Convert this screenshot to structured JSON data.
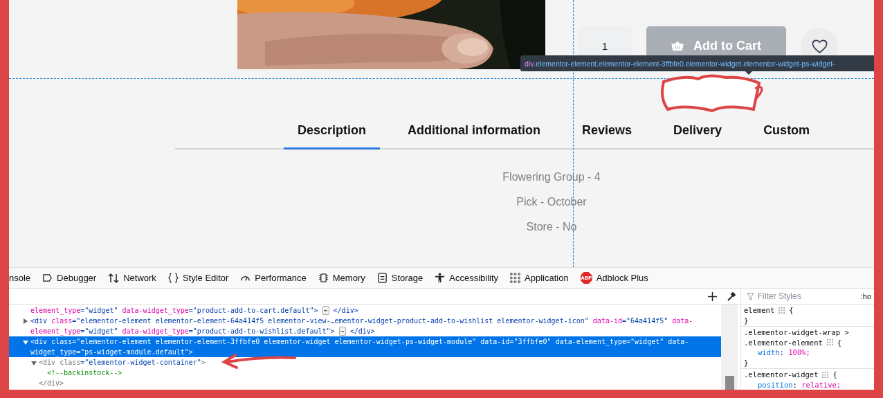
{
  "product": {
    "quantity": "1",
    "add_to_cart": "Add to Cart",
    "wishlist_selected": false
  },
  "highlighter": {
    "tag": "div",
    "selector": ".elementor-element.elementor-element-3ffbfe0.elementor-widget.elementor-widget-ps-widget-"
  },
  "tabs": [
    {
      "label": "Description",
      "selected": true
    },
    {
      "label": "Additional information",
      "selected": false
    },
    {
      "label": "Reviews",
      "selected": false
    },
    {
      "label": "Delivery",
      "selected": false
    },
    {
      "label": "Custom",
      "selected": false
    }
  ],
  "description": [
    "Flowering Group - 4",
    "Pick - October",
    "Store - No"
  ],
  "devtools": {
    "tools": [
      {
        "label": "nsole"
      },
      {
        "label": "Debugger"
      },
      {
        "label": "Network"
      },
      {
        "label": "Style Editor"
      },
      {
        "label": "Performance"
      },
      {
        "label": "Memory"
      },
      {
        "label": "Storage"
      },
      {
        "label": "Accessibility"
      },
      {
        "label": "Application"
      },
      {
        "label": "Adblock Plus",
        "badge": "ABP"
      }
    ],
    "markup": [
      {
        "selected": false,
        "lines": [
          "element_type=\"widget\" data-widget_type=\"product-add-to-cart.default\"> ⋯ </div>"
        ]
      },
      {
        "selected": false,
        "expanded": false,
        "lines": [
          "<div class=\"elementor-element elementor-element-64a414f5 elementor-view-…ementor-widget-product-add-to-wishlist elementor-widget-icon\" data-id=\"64a414f5\" data-",
          "element_type=\"widget\" data-widget_type=\"product-add-to-wishlist.default\"> ⋯ </div>"
        ]
      },
      {
        "selected": true,
        "expanded": true,
        "lines": [
          "<div class=\"elementor-element elementor-element-3ffbfe0 elementor-widget elementor-widget-ps-widget-module\" data-id=\"3ffbfe0\" data-element_type=\"widget\" data-",
          "widget_type=\"ps-widget-module.default\">"
        ],
        "children": [
          {
            "selected": false,
            "expanded": true,
            "lines": [
              "<div class=\"elementor-widget-container\">"
            ],
            "close": "</div>",
            "children": [
              {
                "selected": false,
                "lines": [
                  "<!--backinstock-->"
                ]
              }
            ]
          }
        ]
      }
    ],
    "filter_placeholder": "Filter Styles",
    "pseudo_toggle": ":ho",
    "rules": [
      {
        "selector": [
          "element"
        ],
        "open": "{",
        "close": "}"
      },
      {
        "selector": [
          ".elementor-widget-wrap >",
          ".elementor-element"
        ],
        "open": "{",
        "declarations": [
          "width: 100%;"
        ],
        "close": "}"
      },
      {
        "selector": [
          ".elementor-widget"
        ],
        "open": "{",
        "declarations": [
          "position: relative;"
        ]
      }
    ]
  }
}
